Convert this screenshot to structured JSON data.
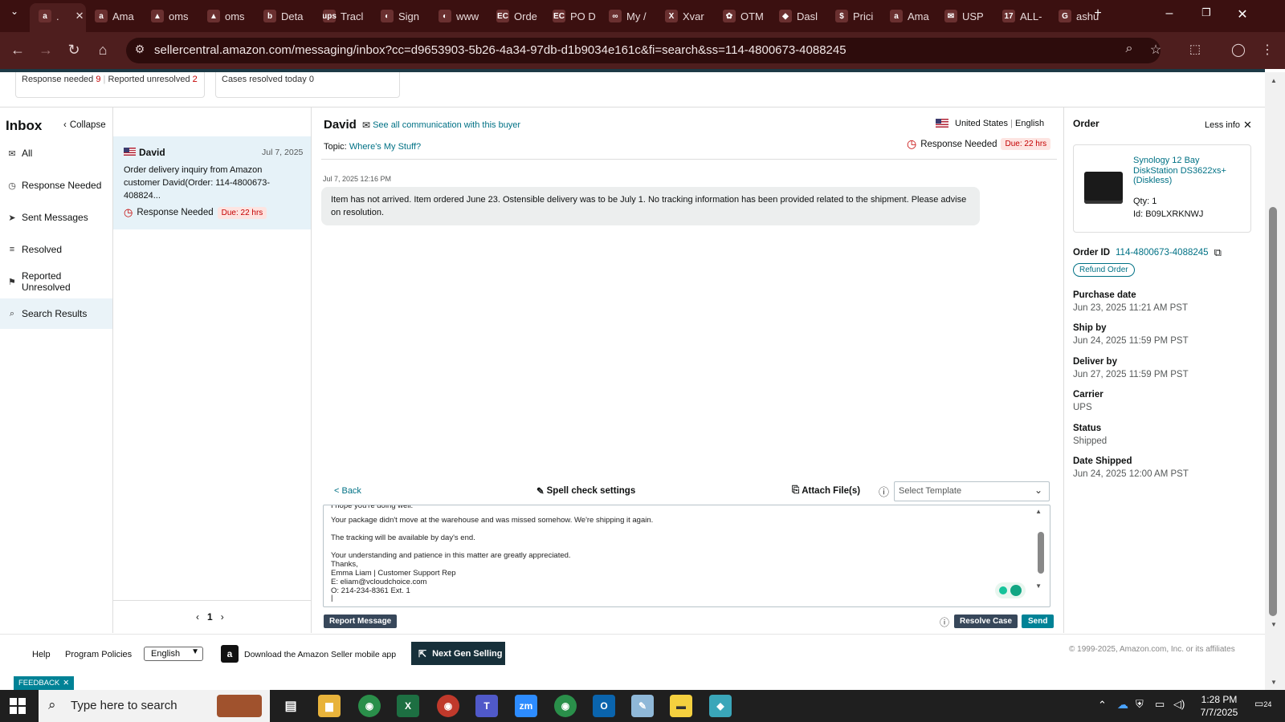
{
  "browser": {
    "tabs": [
      {
        "icon": "a",
        "label": "."
      },
      {
        "icon": "a",
        "label": "Ama"
      },
      {
        "icon": "▲",
        "label": "oms"
      },
      {
        "icon": "▲",
        "label": "oms"
      },
      {
        "icon": "b",
        "label": "Deta"
      },
      {
        "icon": "ups",
        "label": "Tracl"
      },
      {
        "icon": "◐",
        "label": "Sign"
      },
      {
        "icon": "◐",
        "label": "www"
      },
      {
        "icon": "EC",
        "label": "Orde"
      },
      {
        "icon": "EC",
        "label": "PO D"
      },
      {
        "icon": "∞",
        "label": "My /"
      },
      {
        "icon": "X",
        "label": "Xvar"
      },
      {
        "icon": "✿",
        "label": "OTM"
      },
      {
        "icon": "◆",
        "label": "Dasl"
      },
      {
        "icon": "$",
        "label": "Prici"
      },
      {
        "icon": "a",
        "label": "Ama"
      },
      {
        "icon": "✉",
        "label": "USP"
      },
      {
        "icon": "17",
        "label": "ALL-"
      },
      {
        "icon": "G",
        "label": "ashu"
      }
    ],
    "url": "sellercentral.amazon.com/messaging/inbox?cc=d9653903-5b26-4a34-97db-d1b9034e161c&fi=search&ss=114-4800673-4088245"
  },
  "stats": {
    "response_needed_label": "Response needed",
    "response_needed_count": "9",
    "reported_unresolved_label": "Reported unresolved",
    "reported_unresolved_count": "2",
    "cases_resolved": "Cases resolved today 0"
  },
  "inbox": {
    "title": "Inbox",
    "collapse": "Collapse",
    "nav": [
      {
        "label": "All",
        "icon": "mail-icon",
        "glyph": "✉"
      },
      {
        "label": "Response Needed",
        "icon": "clock-icon",
        "glyph": "◷"
      },
      {
        "label": "Sent Messages",
        "icon": "send-icon",
        "glyph": "➤"
      },
      {
        "label": "Resolved",
        "icon": "resolved-icon",
        "glyph": "≡"
      },
      {
        "label": "Reported Unresolved",
        "icon": "report-icon",
        "glyph": "⚑"
      },
      {
        "label": "Search Results",
        "icon": "search-icon",
        "glyph": "⌕"
      }
    ]
  },
  "thread": {
    "buyer": "David",
    "date": "Jul 7, 2025",
    "preview": "Order delivery inquiry from Amazon customer David(Order: 114-4800673-408824...",
    "status": "Response Needed",
    "due": "Due: 22 hrs",
    "page": "1"
  },
  "conversation": {
    "buyer": "David",
    "see_all": "See all communication with this buyer",
    "country": "United States",
    "language": "English",
    "topic_label": "Topic:",
    "topic": "Where's My Stuff?",
    "status": "Response Needed",
    "due": "Due: 22 hrs",
    "message_time": "Jul 7, 2025 12:16 PM",
    "message": "Item has not arrived.  Item ordered June 23.  Ostensible delivery was to be July 1.  No tracking information has been provided related to the shipment.  Please advise on resolution.",
    "back": "< Back",
    "spell_check": "Spell check settings",
    "attach": "Attach File(s)",
    "template_placeholder": "Select Template",
    "reply_lines": [
      "I hope you're doing well.",
      "Your package didn't move at the warehouse and was missed somehow. We're shipping it again.",
      "The tracking will be available by day's end.",
      "Your understanding and patience in this matter are greatly appreciated.",
      " Thanks,",
      "Emma Liam | Customer Support Rep",
      " E: eliam@vcloudchoice.com",
      "O: 214-234-8361 Ext. 1"
    ],
    "report_message": "Report Message",
    "resolve_case": "Resolve Case",
    "send": "Send"
  },
  "order": {
    "title": "Order",
    "less_info": "Less info",
    "product_name": "Synology 12 Bay DiskStation DS3622xs+ (Diskless)",
    "qty": "Qty: 1",
    "id": "Id: B09LXRKNWJ",
    "order_id_label": "Order ID",
    "order_id": "114-4800673-4088245",
    "refund": "Refund Order",
    "details": [
      {
        "label": "Purchase date",
        "value": "Jun 23, 2025 11:21 AM PST"
      },
      {
        "label": "Ship by",
        "value": "Jun 24, 2025 11:59 PM PST"
      },
      {
        "label": "Deliver by",
        "value": "Jun 27, 2025 11:59 PM PST"
      },
      {
        "label": "Carrier",
        "value": "UPS"
      },
      {
        "label": "Status",
        "value": "Shipped"
      },
      {
        "label": "Date Shipped",
        "value": "Jun 24, 2025 12:00 AM PST"
      }
    ]
  },
  "footer": {
    "help": "Help",
    "policies": "Program Policies",
    "language": "English",
    "app": "Download the Amazon Seller mobile app",
    "next_gen": "Next Gen Selling",
    "copyright": "© 1999-2025, Amazon.com, Inc. or its affiliates",
    "feedback": "FEEDBACK"
  },
  "taskbar": {
    "search_placeholder": "Type here to search",
    "time": "1:28 PM",
    "date": "7/7/2025",
    "notifications": "24"
  },
  "colors": {
    "accent_teal": "#007185",
    "due_red": "#c40000",
    "browser_dark": "#3b1010"
  }
}
